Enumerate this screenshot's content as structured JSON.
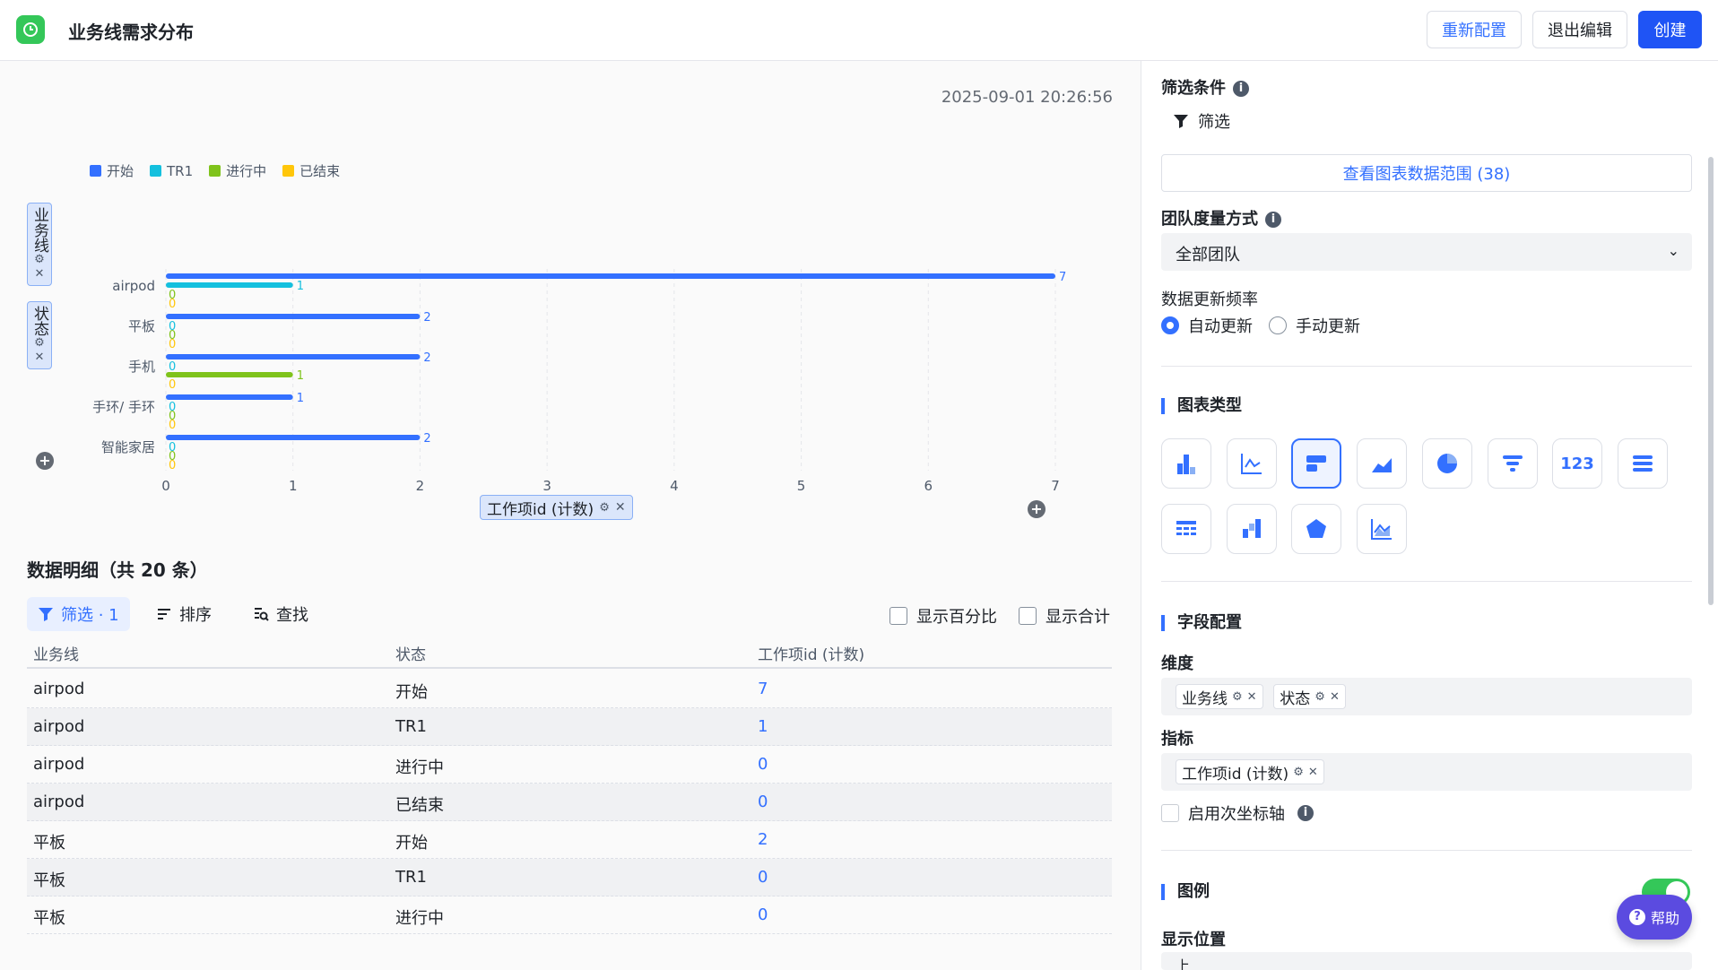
{
  "header": {
    "title": "业务线需求分布",
    "reconfigure": "重新配置",
    "exit_edit": "退出编辑",
    "create": "创建"
  },
  "timestamp": "2025-09-01 20:26:56",
  "chart_data": {
    "type": "bar",
    "orientation": "horizontal",
    "categories": [
      "airpod",
      "平板",
      "手机",
      "手环/ 手环",
      "智能家居"
    ],
    "series": [
      {
        "name": "开始",
        "color": "#3370ff",
        "values": [
          7,
          2,
          2,
          1,
          2
        ]
      },
      {
        "name": "TR1",
        "color": "#14c0de",
        "values": [
          1,
          0,
          0,
          0,
          0
        ]
      },
      {
        "name": "进行中",
        "color": "#7fc31b",
        "values": [
          0,
          0,
          1,
          0,
          0
        ]
      },
      {
        "name": "已结束",
        "color": "#ffc60a",
        "values": [
          0,
          0,
          0,
          0,
          0
        ]
      }
    ],
    "xlim": [
      0,
      7
    ],
    "xticks": [
      "0",
      "1",
      "2",
      "3",
      "4",
      "5",
      "6",
      "7"
    ],
    "grid": true,
    "legend_position": "top-left"
  },
  "axis_pills": {
    "dim1": "业务线",
    "dim2": "状态",
    "metric": "工作项id (计数)"
  },
  "table": {
    "title": "数据明细（共 20 条）",
    "filter": "筛选 · 1",
    "sort": "排序",
    "find": "查找",
    "show_percent": "显示百分比",
    "show_total": "显示合计",
    "columns": [
      "业务线",
      "状态",
      "工作项id (计数)"
    ],
    "rows": [
      [
        "airpod",
        "开始",
        "7"
      ],
      [
        "airpod",
        "TR1",
        "1"
      ],
      [
        "airpod",
        "进行中",
        "0"
      ],
      [
        "airpod",
        "已结束",
        "0"
      ],
      [
        "平板",
        "开始",
        "2"
      ],
      [
        "平板",
        "TR1",
        "0"
      ],
      [
        "平板",
        "进行中",
        "0"
      ]
    ]
  },
  "panel": {
    "filter_title": "筛选条件",
    "filter_btn": "筛选",
    "data_range": "查看图表数据范围 (38)",
    "team_measure": "团队度量方式",
    "team_value": "全部团队",
    "update_freq": "数据更新频率",
    "auto": "自动更新",
    "manual": "手动更新",
    "chart_type": "图表类型",
    "number_icon": "123",
    "field_config": "字段配置",
    "dimension": "维度",
    "dim_tags": [
      "业务线",
      "状态"
    ],
    "metric": "指标",
    "metric_tags": [
      "工作项id (计数)"
    ],
    "secondary_axis": "启用次坐标轴",
    "legend": "图例",
    "display_pos": "显示位置",
    "display_value": "上",
    "help": "帮助"
  },
  "colors": {
    "accent": "#3370ff",
    "logo": "#34c759"
  }
}
